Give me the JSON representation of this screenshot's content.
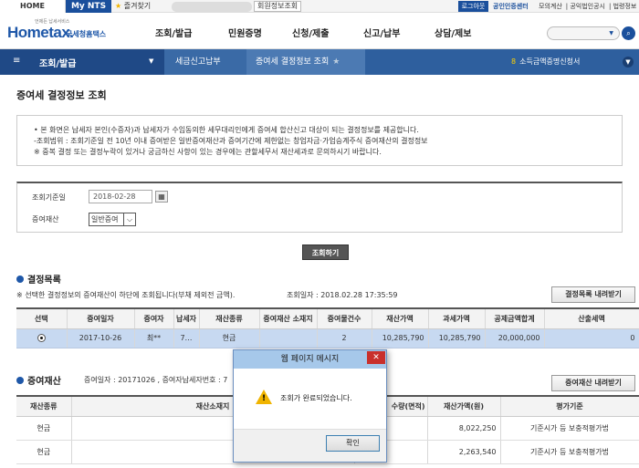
{
  "topbar": {
    "home": "HOME",
    "mynts": "My NTS",
    "favorites": "즐겨찾기",
    "member_info": "회원정보조회",
    "logout": "로그아웃",
    "cert_center": "공인인증센터",
    "links": [
      "모의계산",
      "공익법인공시",
      "법령정보"
    ]
  },
  "header": {
    "slogan": "언제든 납세서비스",
    "logo_text": "Hometax.",
    "logo_sub": "국세청홈택스",
    "gnb": [
      "조회/발급",
      "민원증명",
      "신청/제출",
      "신고/납부",
      "상담/제보"
    ]
  },
  "nav": {
    "section1": "조회/발급",
    "section2": "세금신고납부",
    "section3": "증여세 결정정보 조회",
    "right_num": "8",
    "right_label": "소득금액증명신청서"
  },
  "page": {
    "title": "증여세 결정정보 조회",
    "notice": [
      "• 본 화면은 납세자 본인(수증자)과 납세자가 수임동의한 세무대리인에게 증여세 합산신고 대상이 되는 결정정보를 제공합니다.",
      "  -조회범위 : 조회기준일 전 10년 이내 증여받은 일반증여재산과 증여기간에 제한없는 창업자금·가업승계주식 증여재산의 결정정보",
      "  ※ 중복 결정 또는 결정누락이 있거나 궁금하신 사항이 있는 경우에는 관할세무서 재산세과로 문의하시기 바랍니다."
    ]
  },
  "filter": {
    "date_label": "조회기준일",
    "date_value": "2018-02-28",
    "asset_label": "증여재산",
    "asset_value": "일반증여",
    "search_button": "조회하기"
  },
  "section1": {
    "title": "결정목록",
    "desc": "※ 선택한 결정정보의 증여재산이 하단에 조회됩니다(부채 제외전 금액).",
    "query_time": "조회일자 : 2018.02.28 17:35:59",
    "download": "결정목록 내려받기",
    "headers": [
      "선택",
      "증여일자",
      "증여자",
      "납세자",
      "재산종류",
      "증여재산 소재지",
      "증여물건수",
      "재산가액",
      "과세가액",
      "공제금액합계",
      "산출세액"
    ],
    "row": [
      "",
      "2017-10-26",
      "최**",
      "7…",
      "현금",
      "",
      "2",
      "10,285,790",
      "10,285,790",
      "20,000,000",
      "0"
    ]
  },
  "section2": {
    "title": "증여재산",
    "desc": "증여일자 : 20171026 , 증여자납세자번호 : 7",
    "download": "증여재산 내려받기",
    "headers": [
      "재산종류",
      "재산소재지",
      "수량(면적)",
      "재산가액(원)",
      "평가기준"
    ],
    "rows": [
      [
        "현금",
        "",
        "",
        "8,022,250",
        "기준시가 등 보충적평가법"
      ],
      [
        "현금",
        "",
        "",
        "2,263,540",
        "기준시가 등 보충적평가법"
      ]
    ]
  },
  "dialog": {
    "title": "웹 페이지 메시지",
    "close": "✕",
    "message": "조회가 완료되었습니다.",
    "ok": "확인"
  }
}
